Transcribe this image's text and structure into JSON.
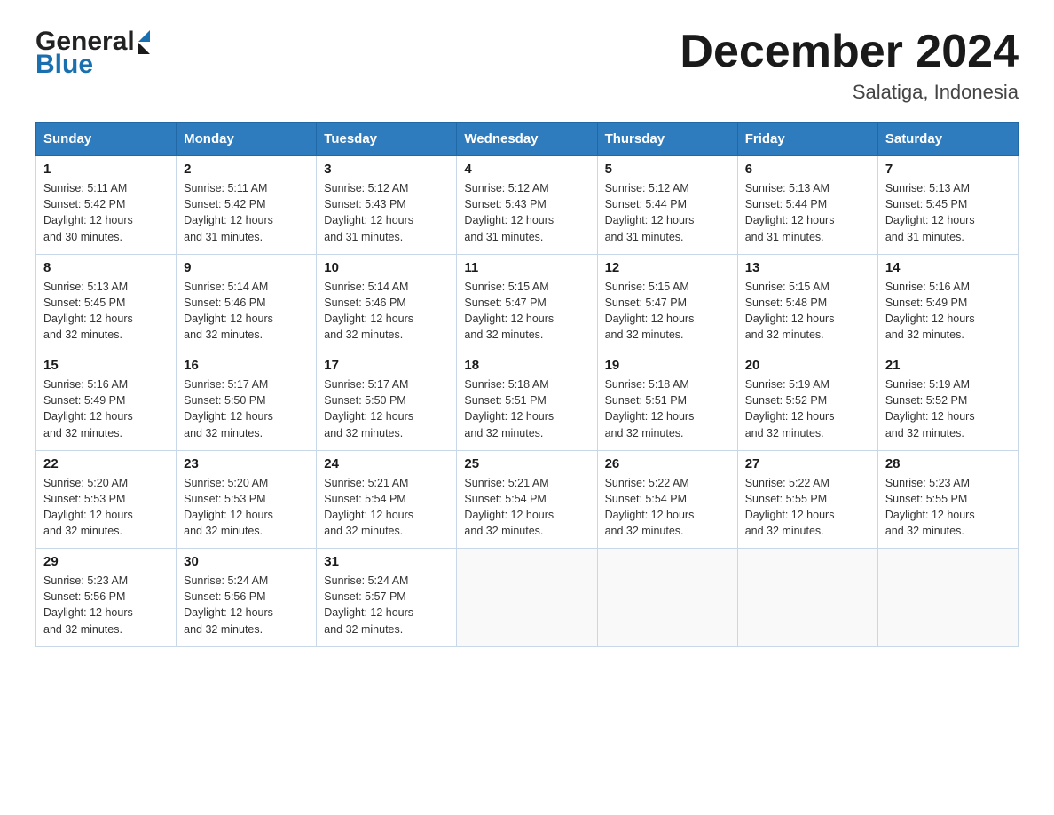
{
  "header": {
    "logo_general": "General",
    "logo_blue": "Blue",
    "month_title": "December 2024",
    "location": "Salatiga, Indonesia"
  },
  "days_of_week": [
    "Sunday",
    "Monday",
    "Tuesday",
    "Wednesday",
    "Thursday",
    "Friday",
    "Saturday"
  ],
  "weeks": [
    [
      {
        "day": "1",
        "sunrise": "5:11 AM",
        "sunset": "5:42 PM",
        "daylight": "12 hours and 30 minutes."
      },
      {
        "day": "2",
        "sunrise": "5:11 AM",
        "sunset": "5:42 PM",
        "daylight": "12 hours and 31 minutes."
      },
      {
        "day": "3",
        "sunrise": "5:12 AM",
        "sunset": "5:43 PM",
        "daylight": "12 hours and 31 minutes."
      },
      {
        "day": "4",
        "sunrise": "5:12 AM",
        "sunset": "5:43 PM",
        "daylight": "12 hours and 31 minutes."
      },
      {
        "day": "5",
        "sunrise": "5:12 AM",
        "sunset": "5:44 PM",
        "daylight": "12 hours and 31 minutes."
      },
      {
        "day": "6",
        "sunrise": "5:13 AM",
        "sunset": "5:44 PM",
        "daylight": "12 hours and 31 minutes."
      },
      {
        "day": "7",
        "sunrise": "5:13 AM",
        "sunset": "5:45 PM",
        "daylight": "12 hours and 31 minutes."
      }
    ],
    [
      {
        "day": "8",
        "sunrise": "5:13 AM",
        "sunset": "5:45 PM",
        "daylight": "12 hours and 32 minutes."
      },
      {
        "day": "9",
        "sunrise": "5:14 AM",
        "sunset": "5:46 PM",
        "daylight": "12 hours and 32 minutes."
      },
      {
        "day": "10",
        "sunrise": "5:14 AM",
        "sunset": "5:46 PM",
        "daylight": "12 hours and 32 minutes."
      },
      {
        "day": "11",
        "sunrise": "5:15 AM",
        "sunset": "5:47 PM",
        "daylight": "12 hours and 32 minutes."
      },
      {
        "day": "12",
        "sunrise": "5:15 AM",
        "sunset": "5:47 PM",
        "daylight": "12 hours and 32 minutes."
      },
      {
        "day": "13",
        "sunrise": "5:15 AM",
        "sunset": "5:48 PM",
        "daylight": "12 hours and 32 minutes."
      },
      {
        "day": "14",
        "sunrise": "5:16 AM",
        "sunset": "5:49 PM",
        "daylight": "12 hours and 32 minutes."
      }
    ],
    [
      {
        "day": "15",
        "sunrise": "5:16 AM",
        "sunset": "5:49 PM",
        "daylight": "12 hours and 32 minutes."
      },
      {
        "day": "16",
        "sunrise": "5:17 AM",
        "sunset": "5:50 PM",
        "daylight": "12 hours and 32 minutes."
      },
      {
        "day": "17",
        "sunrise": "5:17 AM",
        "sunset": "5:50 PM",
        "daylight": "12 hours and 32 minutes."
      },
      {
        "day": "18",
        "sunrise": "5:18 AM",
        "sunset": "5:51 PM",
        "daylight": "12 hours and 32 minutes."
      },
      {
        "day": "19",
        "sunrise": "5:18 AM",
        "sunset": "5:51 PM",
        "daylight": "12 hours and 32 minutes."
      },
      {
        "day": "20",
        "sunrise": "5:19 AM",
        "sunset": "5:52 PM",
        "daylight": "12 hours and 32 minutes."
      },
      {
        "day": "21",
        "sunrise": "5:19 AM",
        "sunset": "5:52 PM",
        "daylight": "12 hours and 32 minutes."
      }
    ],
    [
      {
        "day": "22",
        "sunrise": "5:20 AM",
        "sunset": "5:53 PM",
        "daylight": "12 hours and 32 minutes."
      },
      {
        "day": "23",
        "sunrise": "5:20 AM",
        "sunset": "5:53 PM",
        "daylight": "12 hours and 32 minutes."
      },
      {
        "day": "24",
        "sunrise": "5:21 AM",
        "sunset": "5:54 PM",
        "daylight": "12 hours and 32 minutes."
      },
      {
        "day": "25",
        "sunrise": "5:21 AM",
        "sunset": "5:54 PM",
        "daylight": "12 hours and 32 minutes."
      },
      {
        "day": "26",
        "sunrise": "5:22 AM",
        "sunset": "5:54 PM",
        "daylight": "12 hours and 32 minutes."
      },
      {
        "day": "27",
        "sunrise": "5:22 AM",
        "sunset": "5:55 PM",
        "daylight": "12 hours and 32 minutes."
      },
      {
        "day": "28",
        "sunrise": "5:23 AM",
        "sunset": "5:55 PM",
        "daylight": "12 hours and 32 minutes."
      }
    ],
    [
      {
        "day": "29",
        "sunrise": "5:23 AM",
        "sunset": "5:56 PM",
        "daylight": "12 hours and 32 minutes."
      },
      {
        "day": "30",
        "sunrise": "5:24 AM",
        "sunset": "5:56 PM",
        "daylight": "12 hours and 32 minutes."
      },
      {
        "day": "31",
        "sunrise": "5:24 AM",
        "sunset": "5:57 PM",
        "daylight": "12 hours and 32 minutes."
      },
      null,
      null,
      null,
      null
    ]
  ],
  "labels": {
    "sunrise": "Sunrise:",
    "sunset": "Sunset:",
    "daylight": "Daylight:"
  },
  "colors": {
    "header_bg": "#2e7bbe",
    "header_text": "#ffffff",
    "border": "#b0c4d8",
    "accent_blue": "#1a6faf"
  }
}
